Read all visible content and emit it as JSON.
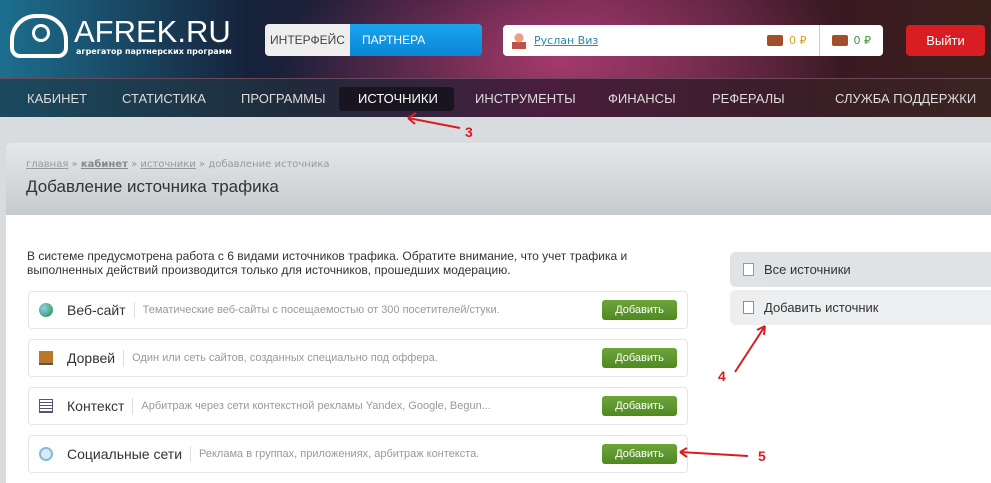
{
  "header": {
    "logo_name": "AFREK.RU",
    "logo_tagline": "агрегатор партнерских программ",
    "interface_label": "ИНТЕРФЕЙС",
    "interface_mode": "ПАРТНЕРА",
    "user_name": "Руслан Виз",
    "balance1": "0 ₽",
    "balance2": "0 ₽",
    "logout": "Выйти",
    "colors": {
      "logout": "#d81e22",
      "mode": "#0a86d6",
      "add": "#5a9a2e"
    }
  },
  "nav": [
    {
      "label": "КАБИНЕТ"
    },
    {
      "label": "СТАТИСТИКА"
    },
    {
      "label": "ПРОГРАММЫ"
    },
    {
      "label": "ИСТОЧНИКИ",
      "active": true
    },
    {
      "label": "ИНСТРУМЕНТЫ"
    },
    {
      "label": "ФИНАНСЫ"
    },
    {
      "label": "РЕФЕРАЛЫ"
    },
    {
      "label": "СЛУЖБА ПОДДЕРЖКИ"
    }
  ],
  "breadcrumb": {
    "home": "главная",
    "sep": "»",
    "cabinet": "кабинет",
    "sources": "источники",
    "current": "добавление источника"
  },
  "page_title": "Добавление источника трафика",
  "intro": "В системе предусмотрена работа с 6 видами источников трафика. Обратите внимание, что учет трафика и выполненных действий производится только для источников, прошедших модерацию.",
  "sources": [
    {
      "name": "Веб-сайт",
      "desc": "Тематические веб-сайты с посещаемостью от 300 посетителей/стуки.",
      "button": "Добавить",
      "icon": "globe-icon"
    },
    {
      "name": "Дорвей",
      "desc": "Один или сеть сайтов, созданных специально под оффера.",
      "button": "Добавить",
      "icon": "door-icon"
    },
    {
      "name": "Контекст",
      "desc": "Арбитраж через сети контекстной рекламы Yandex, Google, Begun...",
      "button": "Добавить",
      "icon": "document-icon"
    },
    {
      "name": "Социальные сети",
      "desc": "Реклама в группах, приложениях, арбитраж контекста.",
      "button": "Добавить",
      "icon": "chat-icon"
    }
  ],
  "sidebar": {
    "all_sources": "Все источники",
    "add_source": "Добавить источник"
  },
  "annotations": [
    "3",
    "4",
    "5"
  ]
}
